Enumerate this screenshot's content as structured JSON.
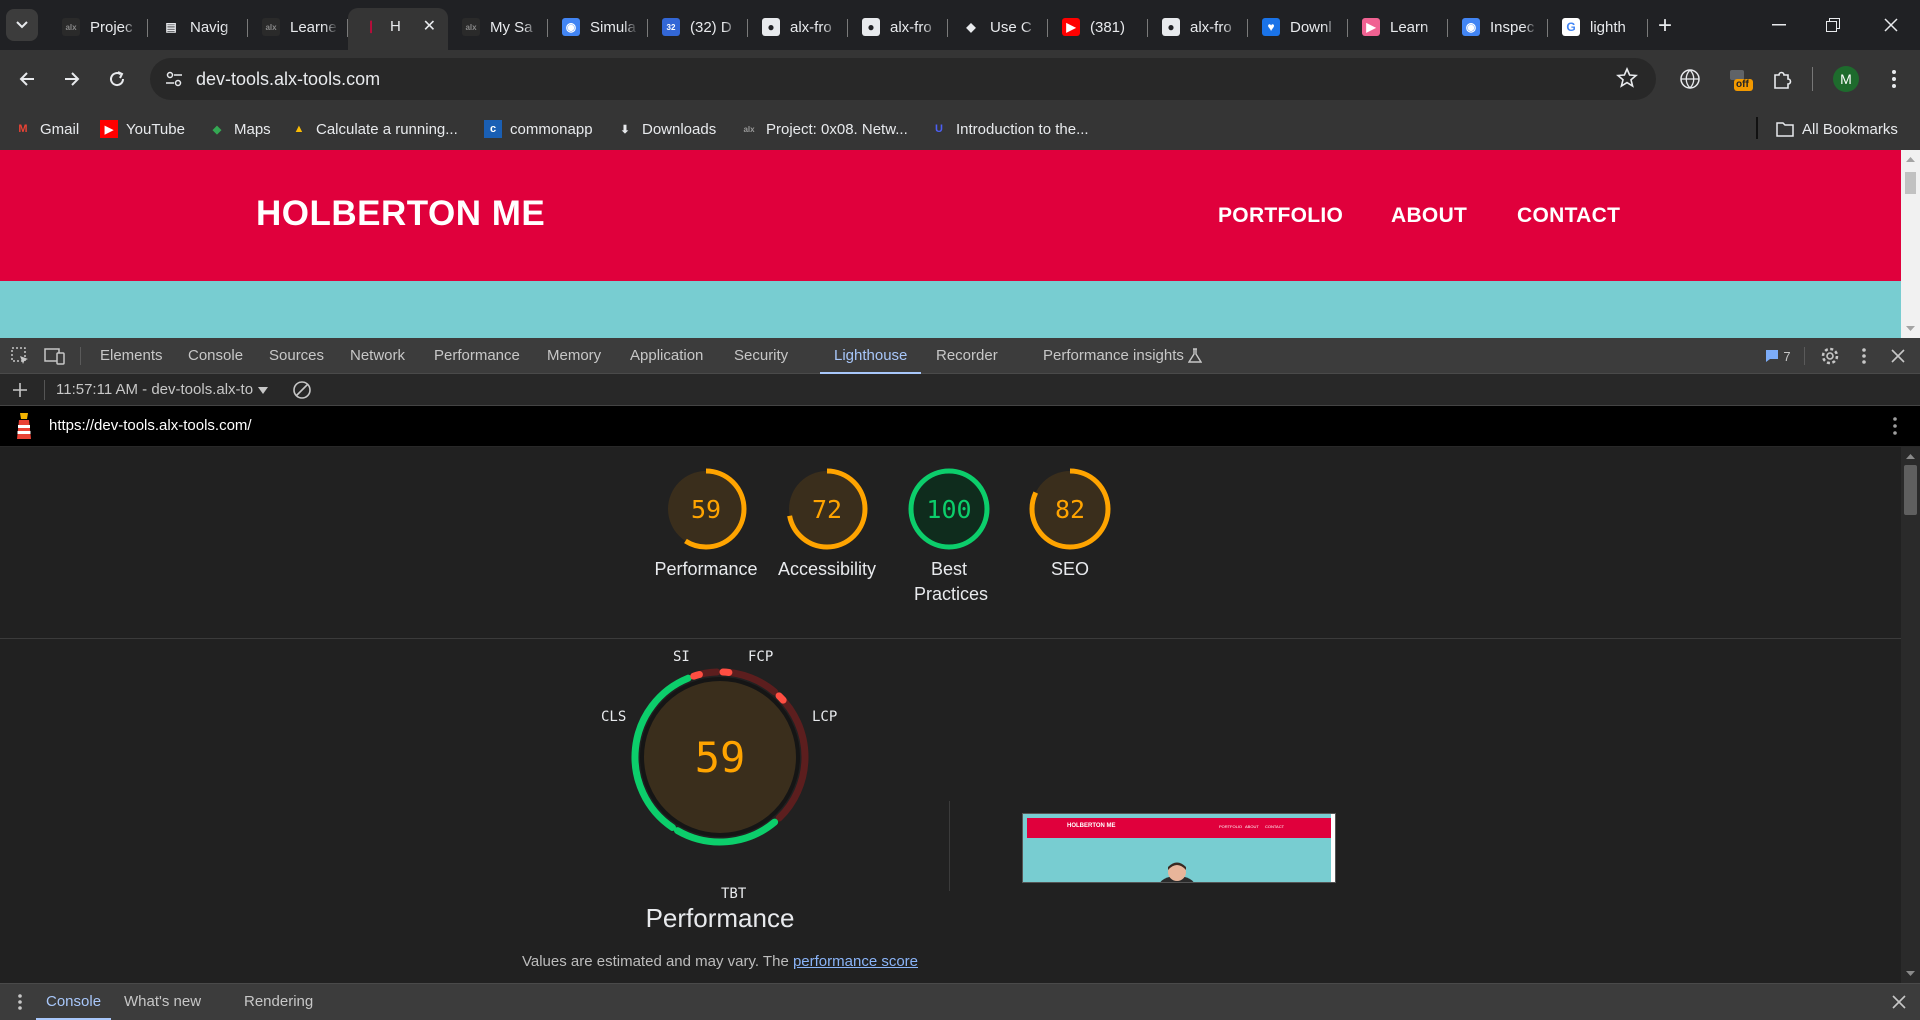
{
  "browser": {
    "tabs": [
      {
        "label": "Projec",
        "icon": "alx-favicon",
        "active": false
      },
      {
        "label": "Navig",
        "icon": "book-icon",
        "active": false
      },
      {
        "label": "Learne",
        "icon": "alx-favicon",
        "active": false
      },
      {
        "label": "H",
        "icon": "holberton-favicon",
        "active": true
      },
      {
        "label": "My Sa",
        "icon": "alx-favicon",
        "active": false
      },
      {
        "label": "Simula",
        "icon": "chrome-icon",
        "active": false
      },
      {
        "label": "(32) D",
        "icon": "notification-favicon",
        "active": false
      },
      {
        "label": "alx-fro",
        "icon": "github-icon",
        "active": false
      },
      {
        "label": "alx-fro",
        "icon": "github-icon",
        "active": false
      },
      {
        "label": "Use C",
        "icon": "use-favicon",
        "active": false
      },
      {
        "label": "(381)",
        "icon": "youtube-icon",
        "active": false
      },
      {
        "label": "alx-fro",
        "icon": "github-icon",
        "active": false
      },
      {
        "label": "Downl",
        "icon": "download-favicon",
        "active": false
      },
      {
        "label": "Learn",
        "icon": "learn-favicon",
        "active": false
      },
      {
        "label": "Inspec",
        "icon": "chrome-icon",
        "active": false
      },
      {
        "label": "lighth",
        "icon": "google-icon",
        "active": false
      }
    ],
    "omnibox_url": "dev-tools.alx-tools.com",
    "extension_badge": "off",
    "avatar_initial": "M",
    "bookmarks": [
      {
        "label": "Gmail",
        "icon": "gmail-icon"
      },
      {
        "label": "YouTube",
        "icon": "youtube-icon"
      },
      {
        "label": "Maps",
        "icon": "maps-icon"
      },
      {
        "label": "Calculate a running...",
        "icon": "drive-icon"
      },
      {
        "label": "commonapp",
        "icon": "commonapp-icon"
      },
      {
        "label": "Downloads",
        "icon": "download-icon"
      },
      {
        "label": "Project: 0x08. Netw...",
        "icon": "alx-favicon"
      },
      {
        "label": "Introduction to the...",
        "icon": "udacity-icon"
      }
    ],
    "all_bookmarks": "All Bookmarks"
  },
  "site": {
    "title": "HOLBERTON ME",
    "nav": [
      "PORTFOLIO",
      "ABOUT",
      "CONTACT"
    ],
    "header_color": "#e0003c",
    "body_color": "#78cdd1"
  },
  "devtools": {
    "tabs": [
      "Elements",
      "Console",
      "Sources",
      "Network",
      "Performance",
      "Memory",
      "Application",
      "Security",
      "Lighthouse",
      "Recorder",
      "Performance insights"
    ],
    "active_tab": "Lighthouse",
    "issues_count": "7",
    "report_selector": "11:57:11 AM - dev-tools.alx-to",
    "report_url": "https://dev-tools.alx-tools.com/",
    "scores": [
      {
        "label": "Performance",
        "value": 59,
        "color": "#ffa400"
      },
      {
        "label": "Accessibility",
        "value": 72,
        "color": "#ffa400"
      },
      {
        "label": "Best Practices",
        "value": 100,
        "color": "#0cce6b"
      },
      {
        "label": "SEO",
        "value": 82,
        "color": "#ffa400"
      }
    ],
    "performance": {
      "score": 59,
      "title": "Performance",
      "metrics": [
        "SI",
        "FCP",
        "LCP",
        "TBT",
        "CLS"
      ],
      "disclaimer_prefix": "Values are estimated and may vary. The ",
      "disclaimer_link": "performance score"
    },
    "drawer_tabs": [
      "Console",
      "What's new",
      "Rendering"
    ],
    "drawer_active": "Console"
  }
}
